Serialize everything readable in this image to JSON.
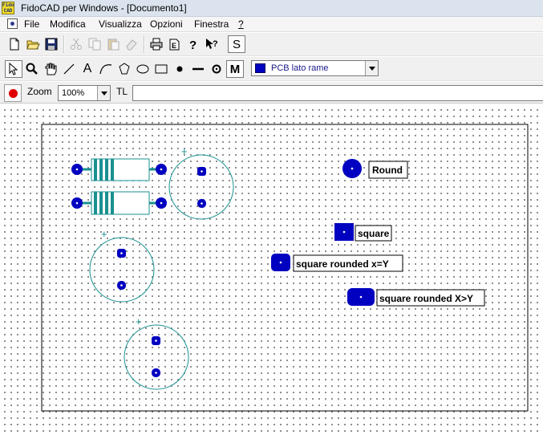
{
  "window": {
    "logo_text": "Fido CAD",
    "title": "FidoCAD per Windows - [Documento1]"
  },
  "menu": {
    "items": [
      {
        "id": "file",
        "label": "File"
      },
      {
        "id": "modifica",
        "label": "Modifica"
      },
      {
        "id": "visualizza",
        "label": "Visualizza"
      },
      {
        "id": "opzioni",
        "label": "Opzioni"
      },
      {
        "id": "finestra",
        "label": "Finestra"
      },
      {
        "id": "help",
        "label": "?"
      }
    ]
  },
  "toolbar_main": {
    "buttons": [
      "new-document-icon",
      "open-folder-icon",
      "save-disk-icon",
      "cut-scissors-icon",
      "copy-icon",
      "paste-icon",
      "eraser-icon",
      "print-icon",
      "export-icon",
      "help-question-icon",
      "context-help-icon",
      "snap-s-icon"
    ],
    "snap_label": "S"
  },
  "toolbar_tools": {
    "tools": [
      "select-arrow-icon",
      "zoom-magnifier-icon",
      "pan-hand-icon",
      "line-tool-icon",
      "text-tool-icon",
      "bezier-tool-icon",
      "polygon-tool-icon",
      "ellipse-tool-icon",
      "rectangle-tool-icon",
      "pcb-pad-tool-icon",
      "pcb-line-tool-icon",
      "connection-tool-icon",
      "macro-tool-icon"
    ],
    "text_tool_label": "A",
    "macro_tool_label": "M",
    "layer": {
      "selected": "PCB lato rame",
      "color": "#0000c0"
    }
  },
  "toolbar_zoom": {
    "zoom_label": "Zoom",
    "zoom_value": "100%",
    "tl_label": "TL",
    "tl_value": ""
  },
  "drawing": {
    "colors": {
      "pad": "#0000c0",
      "outline": "#1a9090",
      "frame": "#000000",
      "text": "#000000"
    },
    "labels": {
      "round": "Round",
      "square": "square",
      "square_rounded_eq": "square rounded x=Y",
      "square_rounded_gt": "square rounded X>Y"
    },
    "polarity_symbol": "+"
  }
}
